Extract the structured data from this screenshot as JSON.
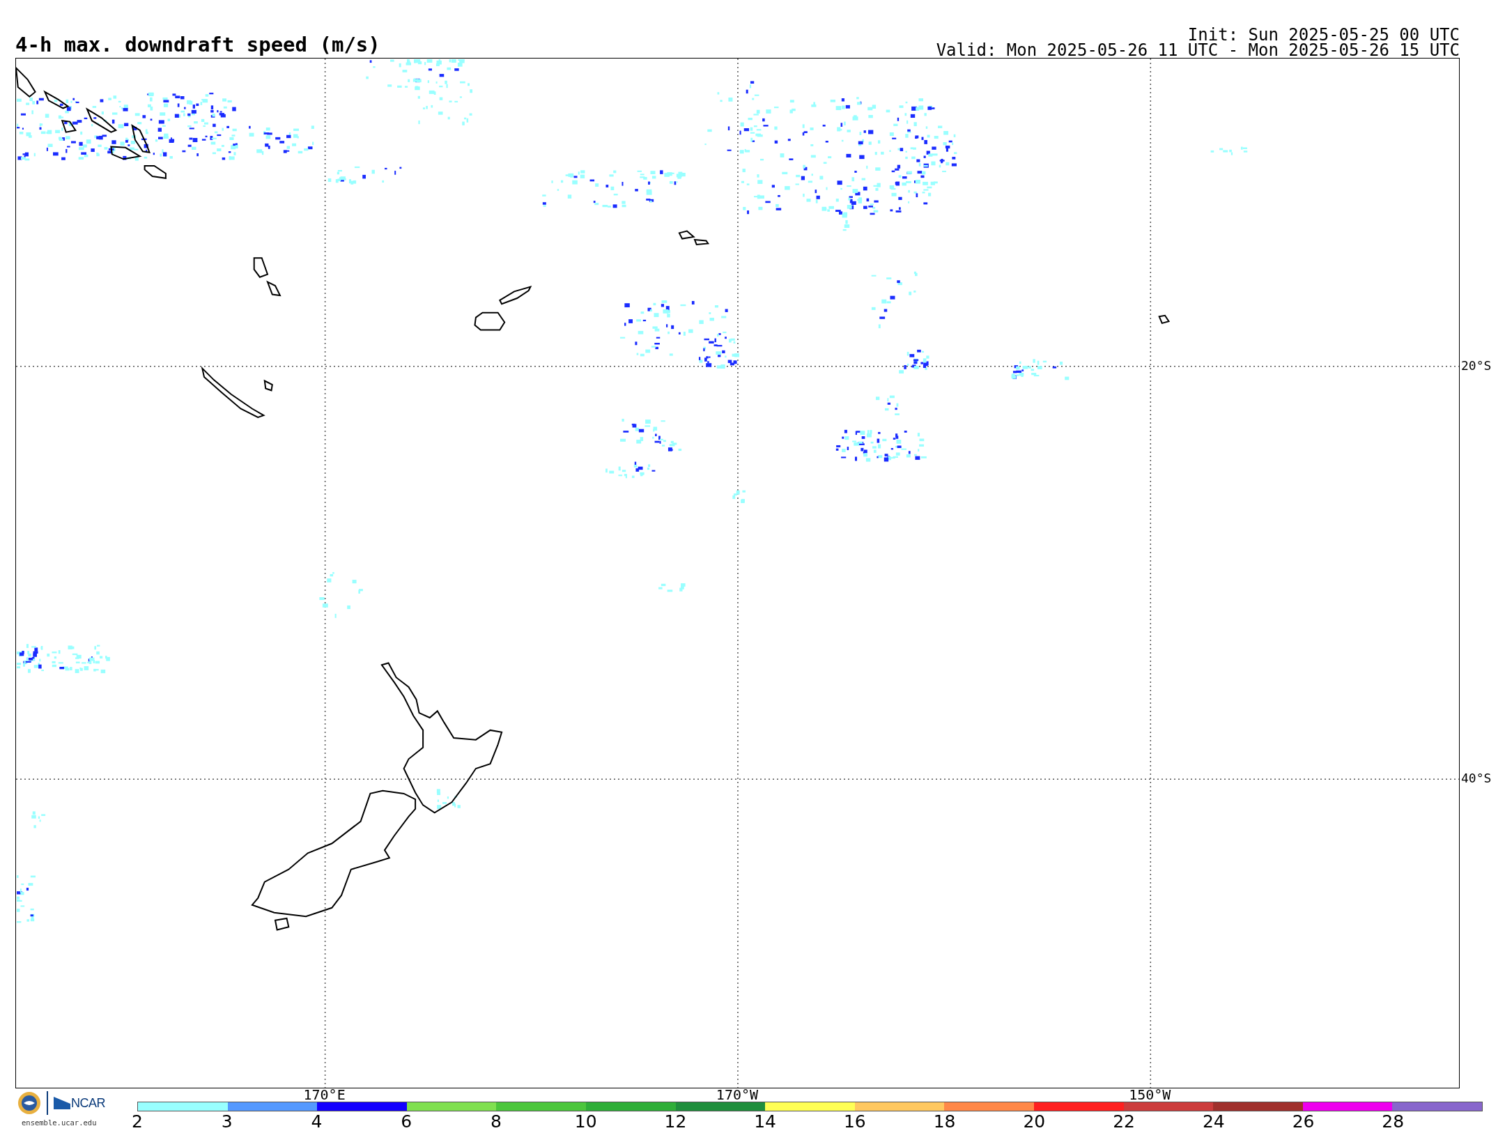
{
  "title": "4-h max. downdraft speed (m/s)",
  "init": "Init: Sun 2025-05-25 00 UTC",
  "valid": "Valid: Mon 2025-05-26 11 UTC - Mon 2025-05-26 15 UTC",
  "map": {
    "lat_labels": [
      "20°S",
      "40°S"
    ],
    "lon_labels": [
      "170°E",
      "170°W",
      "150°W"
    ]
  },
  "colorbar": {
    "bins": [
      {
        "color": "#99ffff"
      },
      {
        "color": "#5599ff"
      },
      {
        "color": "#1400ff"
      },
      {
        "color": "#80e050"
      },
      {
        "color": "#4cc63c"
      },
      {
        "color": "#2fae38"
      },
      {
        "color": "#1f8e3c"
      },
      {
        "color": "#ffff55"
      },
      {
        "color": "#ffc860"
      },
      {
        "color": "#ff8848"
      },
      {
        "color": "#ff2020"
      },
      {
        "color": "#cc3c3c"
      },
      {
        "color": "#a0302c"
      },
      {
        "color": "#ee00ee"
      },
      {
        "color": "#8866cc"
      }
    ],
    "ticks": [
      "2",
      "3",
      "4",
      "6",
      "8",
      "10",
      "12",
      "14",
      "16",
      "18",
      "20",
      "22",
      "24",
      "26",
      "28"
    ]
  },
  "footer": {
    "org": "NCAR",
    "site": "ensemble.ucar.edu"
  }
}
